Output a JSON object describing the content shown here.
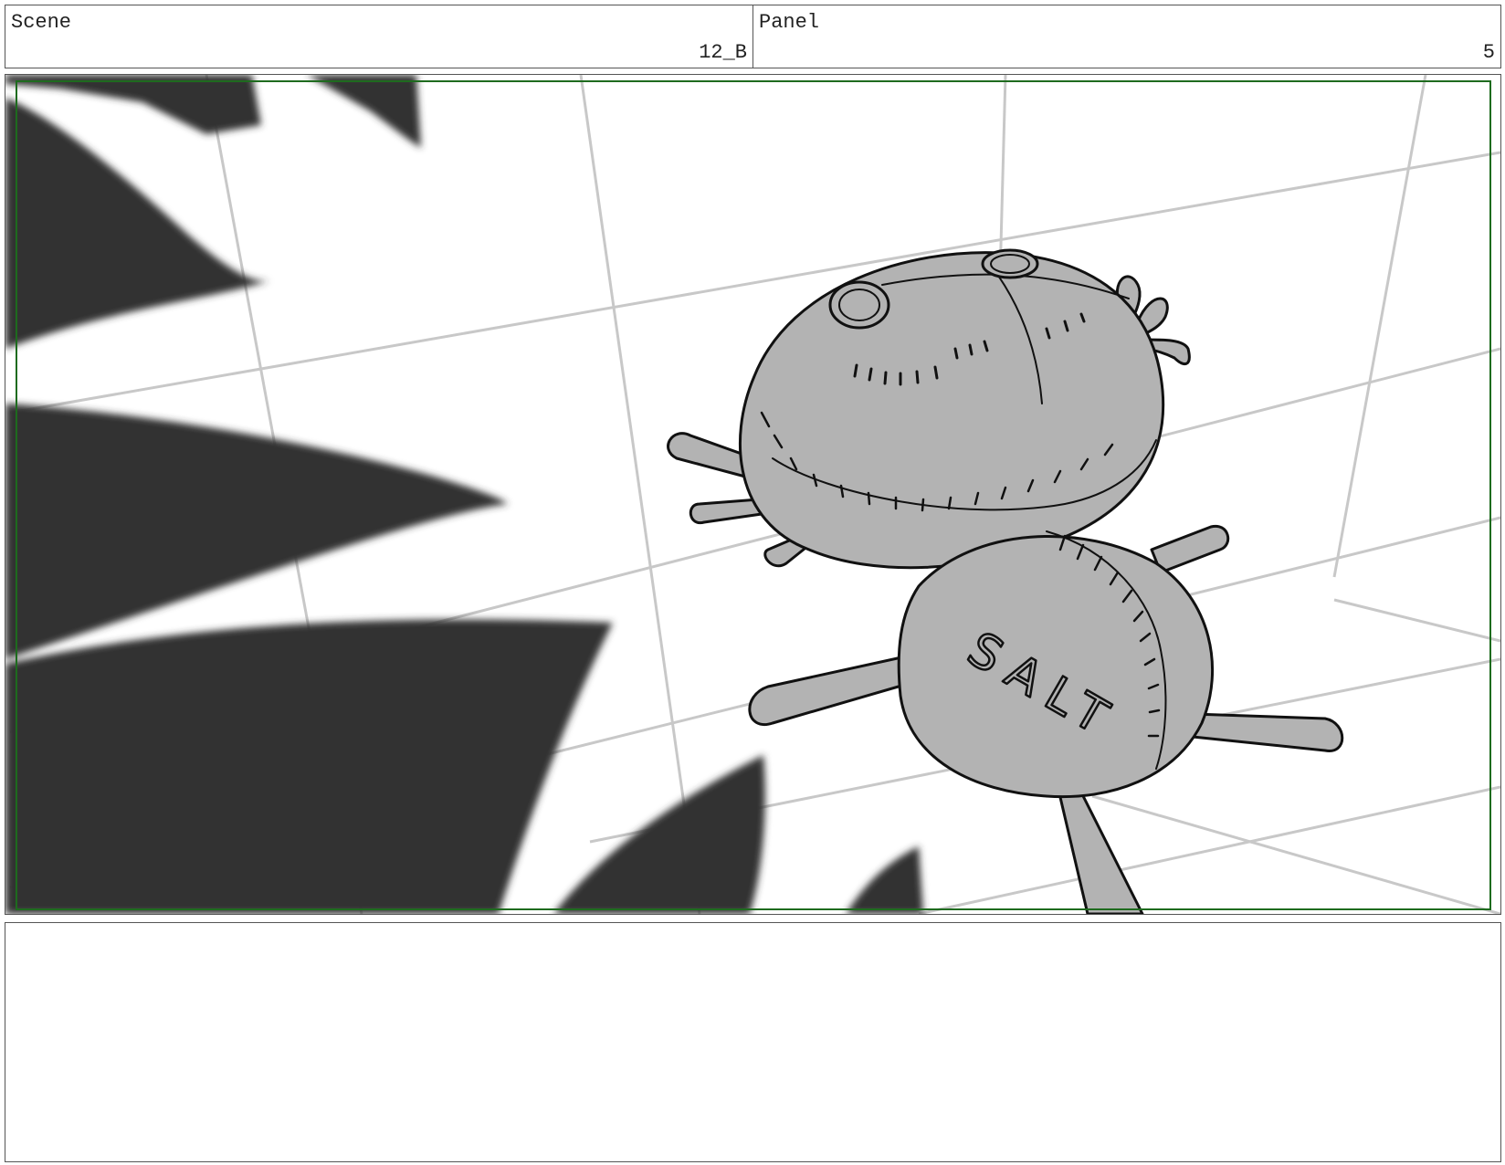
{
  "header": {
    "scene_label": "Scene",
    "scene_value": "12_B",
    "panel_label": "Panel",
    "panel_value": "5"
  },
  "drawing": {
    "lettering": "SALT",
    "colors": {
      "safe_frame": "#1e6b1e",
      "grid": "#c8c8c8",
      "foreground_leaves": "#333333",
      "doll_fill": "#b3b3b3",
      "ink": "#111111"
    }
  },
  "notes": {
    "text": ""
  }
}
